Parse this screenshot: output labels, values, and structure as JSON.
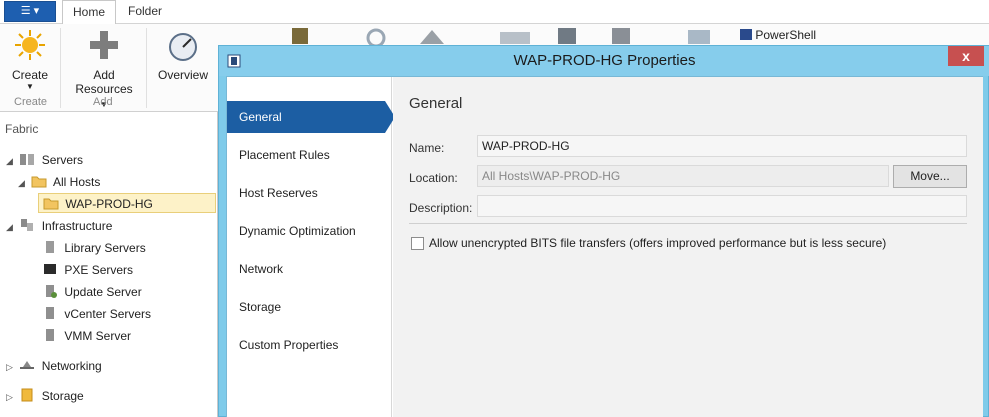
{
  "tabs": {
    "home": "Home",
    "folder": "Folder"
  },
  "ribbon": {
    "create_label": "Create",
    "create_group": "Create",
    "add_resources_line1": "Add",
    "add_resources_line2": "Resources",
    "add_group": "Add",
    "overview_label": "Overview",
    "powershell_label": "PowerShell"
  },
  "nav": {
    "header": "Fabric",
    "items": [
      {
        "label": "Servers",
        "icon": "servers-icon"
      },
      {
        "label": "All Hosts",
        "icon": "folder-icon"
      },
      {
        "label": "WAP-PROD-HG",
        "icon": "folder-icon"
      },
      {
        "label": "Infrastructure",
        "icon": "infrastructure-icon"
      },
      {
        "label": "Library Servers",
        "icon": "library-server-icon"
      },
      {
        "label": "PXE Servers",
        "icon": "pxe-server-icon"
      },
      {
        "label": "Update Server",
        "icon": "update-server-icon"
      },
      {
        "label": "vCenter Servers",
        "icon": "vcenter-server-icon"
      },
      {
        "label": "VMM Server",
        "icon": "vmm-server-icon"
      },
      {
        "label": "Networking",
        "icon": "networking-icon"
      },
      {
        "label": "Storage",
        "icon": "storage-icon"
      }
    ]
  },
  "dialog": {
    "title": "WAP-PROD-HG Properties",
    "close_glyph": "x",
    "nav": [
      "General",
      "Placement Rules",
      "Host Reserves",
      "Dynamic Optimization",
      "Network",
      "Storage",
      "Custom Properties"
    ],
    "section_title": "General",
    "name_label": "Name:",
    "name_value": "WAP-PROD-HG",
    "location_label": "Location:",
    "location_value": "All Hosts\\WAP-PROD-HG",
    "move_button": "Move...",
    "description_label": "Description:",
    "description_value": "",
    "bits_checkbox_label": "Allow unencrypted BITS file transfers (offers improved performance but is less secure)",
    "bits_checked": false
  },
  "colors": {
    "dialog_frame": "#86cdec",
    "nav_selected": "#1c5ea3",
    "tree_selected": "#fdf2c8"
  }
}
